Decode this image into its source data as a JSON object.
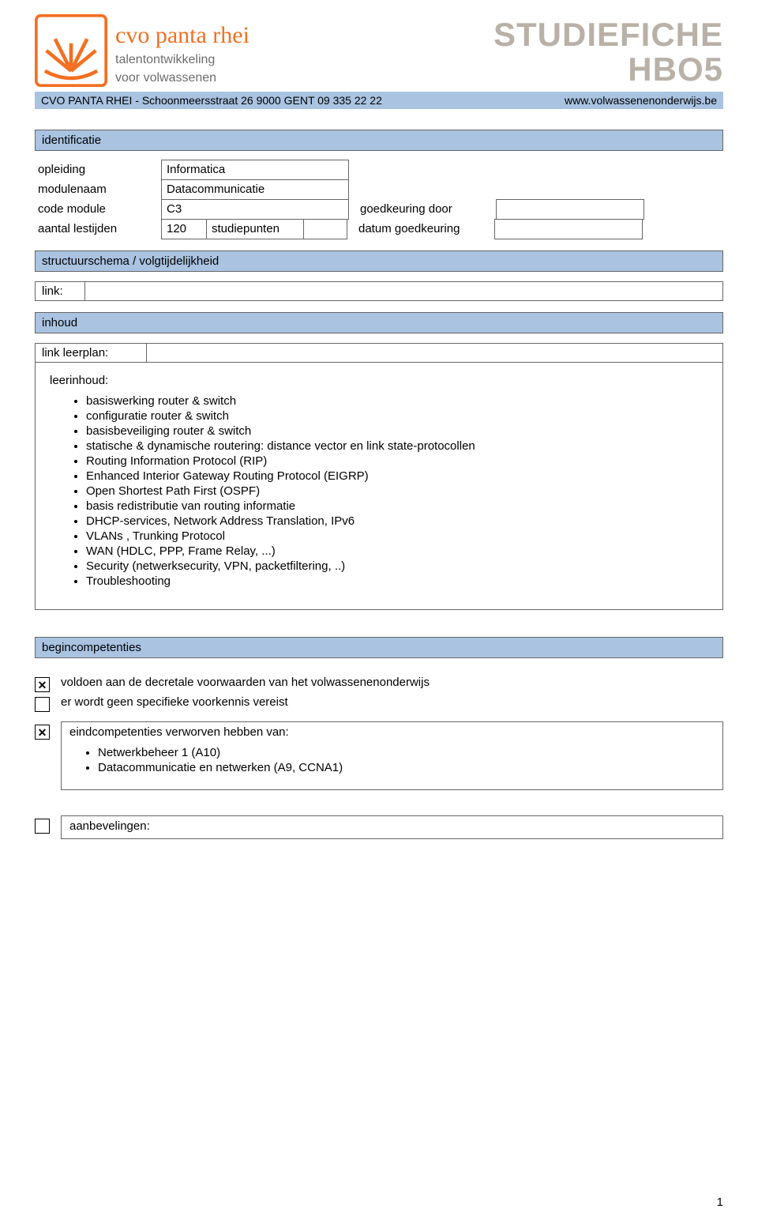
{
  "header": {
    "brand_name": "cvo panta rhei",
    "tagline_1": "talentontwikkeling",
    "tagline_2": "voor volwassenen",
    "title_1": "STUDIEFICHE",
    "title_2": "HBO5"
  },
  "address": {
    "left": "CVO PANTA RHEI  -  Schoonmeersstraat 26   9000   GENT   09 335 22 22",
    "right": "www.volwassenenonderwijs.be"
  },
  "sections": {
    "identificatie": "identificatie",
    "structuur": "structuurschema / volgtijdelijkheid",
    "inhoud": "inhoud",
    "begincompetenties": "begincompetenties"
  },
  "identificatie": {
    "opleiding_label": "opleiding",
    "opleiding_value": "Informatica",
    "modulenaam_label": "modulenaam",
    "modulenaam_value": "Datacommunicatie",
    "codemodule_label": "code module",
    "codemodule_value": "C3",
    "goedkeuring_door_label": "goedkeuring door",
    "goedkeuring_door_value": "",
    "lestijden_label": "aantal lestijden",
    "lestijden_value": "120",
    "studiepunten_label": "studiepunten",
    "studiepunten_value": "",
    "datum_label": "datum goedkeuring",
    "datum_value": ""
  },
  "structuur": {
    "link_label": "link:",
    "link_value": ""
  },
  "inhoud": {
    "leerplan_label": "link leerplan:",
    "leerplan_value": "",
    "leerinhoud_label": "leerinhoud:",
    "items": [
      "basiswerking router & switch",
      "configuratie router & switch",
      "basisbeveiliging router & switch",
      "statische & dynamische routering: distance vector en link state-protocollen",
      "Routing Information Protocol (RIP)",
      "Enhanced Interior Gateway Routing Protocol (EIGRP)",
      "Open Shortest Path First (OSPF)",
      "basis redistributie van routing informatie",
      "DHCP-services, Network Address Translation, IPv6",
      "VLANs , Trunking Protocol",
      "WAN (HDLC, PPP, Frame Relay, ...)",
      "Security (netwerksecurity, VPN, packetfiltering, ..)",
      "Troubleshooting"
    ]
  },
  "begincompetenties": {
    "item1": "voldoen aan de decretale voorwaarden van het volwassenenonderwijs",
    "item2": "er wordt geen specifieke voorkennis vereist",
    "item3_label": "eindcompetenties verworven hebben van:",
    "item3_bullets": [
      "Netwerkbeheer 1 (A10)",
      "Datacommunicatie en netwerken (A9, CCNA1)"
    ],
    "aanbevelingen_label": "aanbevelingen:"
  },
  "page_number": "1"
}
